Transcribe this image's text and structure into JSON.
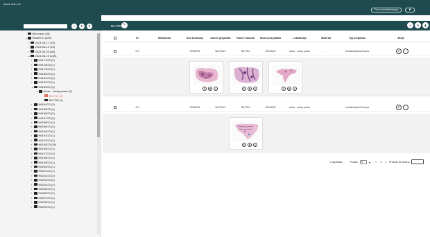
{
  "app": {
    "logo_text": "MSU",
    "logo_subtext": "Medical Slides Unit",
    "admin_button": "Panel administracyjny",
    "user_icon": "user-icon"
  },
  "sidebar": {
    "search_placeholder": "",
    "buttons": [
      "folder-plus-icon",
      "refresh-icon",
      "search-icon"
    ],
    "tree": [
      {
        "label": "Nieznane (18)",
        "level": 0,
        "red": false
      },
      {
        "label": "PatARCH (849)",
        "level": 0,
        "red": false
      },
      {
        "label": "2023-04-17 (24)",
        "level": 1,
        "red": false
      },
      {
        "label": "2023-04-19 (43)",
        "level": 1,
        "red": false
      },
      {
        "label": "2023-05-09 (66)",
        "level": 1,
        "red": false
      },
      {
        "label": "2023-05-10 (245)",
        "level": 1,
        "red": false
      },
      {
        "label": "H6171/23 (2)",
        "level": 2,
        "red": false
      },
      {
        "label": "H6176/23 (1)",
        "level": 2,
        "red": false
      },
      {
        "label": "H6179/23 (1)",
        "level": 2,
        "red": false
      },
      {
        "label": "H6180/23 (2)",
        "level": 2,
        "red": false
      },
      {
        "label": "H6181/23 (2)",
        "level": 2,
        "red": false
      },
      {
        "label": "H6182/23 (1)",
        "level": 2,
        "red": false
      },
      {
        "label": "H6183/23 (3)",
        "level": 2,
        "red": false
      },
      {
        "label": "skóra - ramię prawe (3)",
        "level": 3,
        "red": false
      },
      {
        "label": "BA7764 (2)",
        "level": 4,
        "red": true
      },
      {
        "label": "BA7765 (1)",
        "level": 4,
        "red": false
      },
      {
        "label": "H6184/23 (3)",
        "level": 2,
        "red": false
      },
      {
        "label": "H6185/23 (4)",
        "level": 2,
        "red": false
      },
      {
        "label": "H6186/23 (3)",
        "level": 2,
        "red": false
      },
      {
        "label": "H6187/23 (3)",
        "level": 2,
        "red": false
      },
      {
        "label": "H6188/23 (1)",
        "level": 2,
        "red": false
      },
      {
        "label": "H6189/23 (3)",
        "level": 2,
        "red": false
      },
      {
        "label": "H6190/23 (2)",
        "level": 2,
        "red": false
      },
      {
        "label": "H6191/23 (1)",
        "level": 2,
        "red": false
      },
      {
        "label": "H6193/23 (3)",
        "level": 2,
        "red": false
      },
      {
        "label": "H6195/23 (26)",
        "level": 2,
        "red": false
      },
      {
        "label": "H6196/23 (1)",
        "level": 2,
        "red": false
      },
      {
        "label": "H6197/23 (3)",
        "level": 2,
        "red": false
      },
      {
        "label": "H6198/23 (1)",
        "level": 2,
        "red": false
      },
      {
        "label": "H6199/23 (1)",
        "level": 2,
        "red": false
      },
      {
        "label": "H6200/23 (1)",
        "level": 2,
        "red": false
      },
      {
        "label": "H6201/23 (1)",
        "level": 2,
        "red": false
      },
      {
        "label": "H6202/23 (3)",
        "level": 2,
        "red": false
      },
      {
        "label": "H6203/23 (2)",
        "level": 2,
        "red": false
      },
      {
        "label": "H6204/23 (2)",
        "level": 2,
        "red": false
      },
      {
        "label": "H6205/23 (1)",
        "level": 2,
        "red": false
      },
      {
        "label": "H6206/23 (2)",
        "level": 2,
        "red": false
      },
      {
        "label": "H6207/23 (1)",
        "level": 2,
        "red": false
      },
      {
        "label": "H6208/23 (1)",
        "level": 2,
        "red": false
      },
      {
        "label": "H6209/23 (1)",
        "level": 2,
        "red": false
      }
    ]
  },
  "main": {
    "breadcrumb": "BA7764",
    "header_buttons": [
      "expand-icon",
      "refresh-icon",
      "delete-icon"
    ],
    "columns": [
      "ID",
      "Miniaturka",
      "Kod kreskowy",
      "Numer preparatu",
      "Numer bloczka",
      "Numer przypadku",
      "Lokalizacja",
      "Materiał",
      "Typ preparatu",
      "Akcje"
    ],
    "rows": [
      {
        "id": "373",
        "miniature": "",
        "barcode": "RI058793",
        "slide_no": "BA7764/1",
        "block_no": "BA7764",
        "case_no": "H6183/23",
        "location": "skóra - ramię prawe",
        "material": "-",
        "slide_type": "hematoksylina-Eozyna",
        "thumbs": 3
      },
      {
        "id": "174",
        "miniature": "",
        "barcode": "RI058793",
        "slide_no": "BA7764/1",
        "block_no": "BA7764",
        "case_no": "H6183/23",
        "location": "skóra - ramię prawe",
        "material": "-",
        "slide_type": "hematoksylina-Eozyna",
        "thumbs": 1
      }
    ],
    "pagination": {
      "results": "2 wyników",
      "per_page_label": "Pokaż:",
      "per_page_value": "5",
      "prev": "<",
      "page": "1",
      "next": ">",
      "goto_label": "Przejdź do strony:"
    }
  },
  "colors": {
    "header": "#1e4a50",
    "accent_red": "#e36b5c"
  }
}
